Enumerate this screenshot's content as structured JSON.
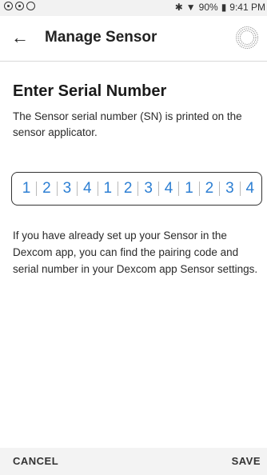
{
  "status_bar": {
    "bluetooth_icon": "bluetooth-icon",
    "wifi_icon": "wifi-icon",
    "battery_percent": "90%",
    "time": "9:41 PM"
  },
  "app_bar": {
    "title": "Manage Sensor",
    "back_icon": "arrow-left-icon",
    "logo_icon": "dexcom-logo-icon"
  },
  "content": {
    "heading": "Enter Serial Number",
    "description": "The Sensor serial number (SN) is printed on the sensor applicator.",
    "serial_digits": [
      "1",
      "2",
      "3",
      "4",
      "1",
      "2",
      "3",
      "4",
      "1",
      "2",
      "3",
      "4"
    ],
    "info": "If you have already set up your Sensor in the Dexcom app, you can find the pairing code and serial number in your Dexcom app Sensor settings."
  },
  "actions": {
    "cancel": "CANCEL",
    "save": "SAVE"
  },
  "colors": {
    "accent": "#2d7fd3",
    "text": "#222222",
    "bottom_bar": "#f3f3f3"
  }
}
